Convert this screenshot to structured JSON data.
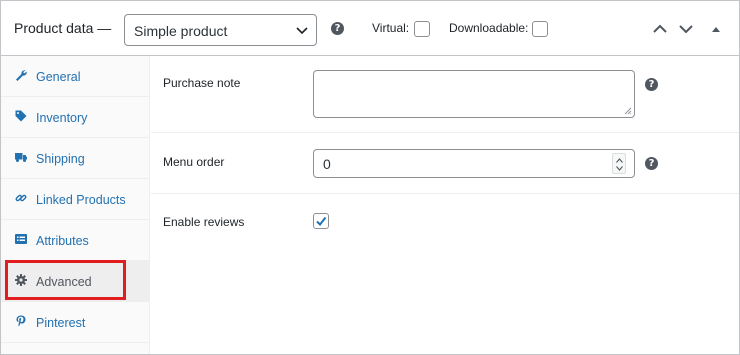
{
  "header": {
    "title": "Product data —",
    "product_type": {
      "selected": "Simple product"
    },
    "help_glyph": "?",
    "virtual_label": "Virtual:",
    "virtual_checked": false,
    "downloadable_label": "Downloadable:",
    "downloadable_checked": false,
    "icons": [
      "chevron-up-icon",
      "chevron-down-icon",
      "triangle-up-icon"
    ]
  },
  "sidebar": {
    "items": [
      {
        "label": "General",
        "icon": "wrench-icon",
        "active": false
      },
      {
        "label": "Inventory",
        "icon": "tag-icon",
        "active": false
      },
      {
        "label": "Shipping",
        "icon": "truck-icon",
        "active": false
      },
      {
        "label": "Linked Products",
        "icon": "link-icon",
        "active": false
      },
      {
        "label": "Attributes",
        "icon": "list-icon",
        "active": false
      },
      {
        "label": "Advanced",
        "icon": "gear-icon",
        "active": true
      },
      {
        "label": "Pinterest",
        "icon": "pinterest-icon",
        "active": false
      }
    ]
  },
  "main": {
    "purchase_note": {
      "label": "Purchase note",
      "value": ""
    },
    "menu_order": {
      "label": "Menu order",
      "value": "0"
    },
    "enable_reviews": {
      "label": "Enable reviews",
      "checked": true
    }
  },
  "colors": {
    "link": "#2271b1",
    "highlight": "#e01e1e",
    "active_tab_bg": "#eeeeee"
  }
}
